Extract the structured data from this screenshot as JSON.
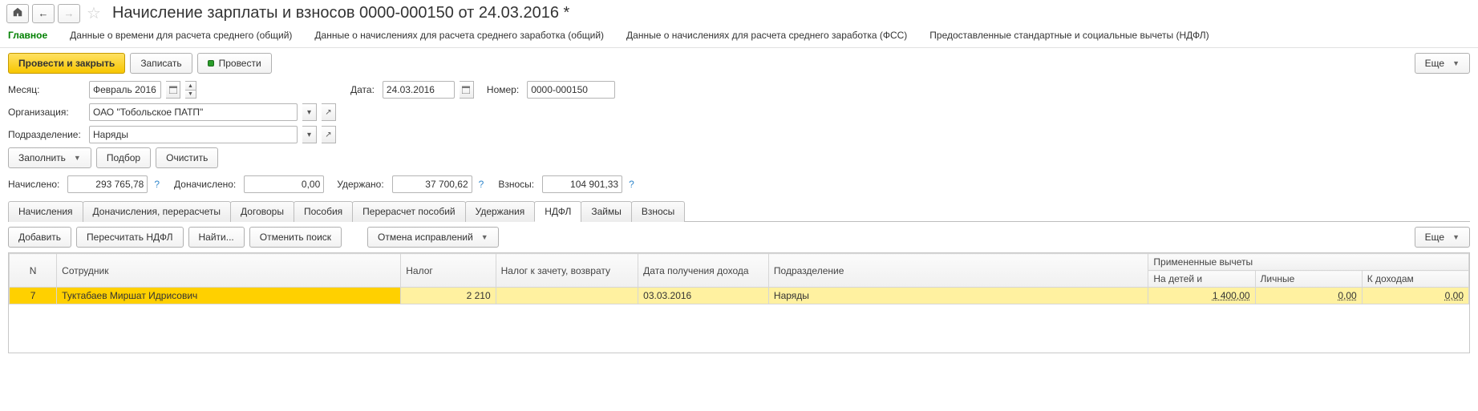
{
  "title": "Начисление зарплаты и взносов 0000-000150 от 24.03.2016 *",
  "subtabs": {
    "main": "Главное",
    "avgTime": "Данные о времени для расчета среднего (общий)",
    "avgEarnGeneral": "Данные о начислениях для расчета среднего заработка (общий)",
    "avgEarnFSS": "Данные о начислениях для расчета среднего заработка (ФСС)",
    "deductions": "Предоставленные стандартные и социальные вычеты (НДФЛ)"
  },
  "toolbar": {
    "postClose": "Провести и закрыть",
    "save": "Записать",
    "post": "Провести",
    "more": "Еще"
  },
  "form": {
    "monthLabel": "Месяц:",
    "month": "Февраль 2016",
    "dateLabel": "Дата:",
    "date": "24.03.2016",
    "numberLabel": "Номер:",
    "number": "0000-000150",
    "orgLabel": "Организация:",
    "org": "ОАО \"Тобольское ПАТП\"",
    "deptLabel": "Подразделение:",
    "dept": "Наряды"
  },
  "fillBar": {
    "fill": "Заполнить",
    "pick": "Подбор",
    "clear": "Очистить"
  },
  "totals": {
    "accruedLabel": "Начислено:",
    "accrued": "293 765,78",
    "extraLabel": "Доначислено:",
    "extra": "0,00",
    "withheldLabel": "Удержано:",
    "withheld": "37 700,62",
    "feesLabel": "Взносы:",
    "fees": "104 901,33"
  },
  "sectionTabs": {
    "accruals": "Начисления",
    "recalc": "Доначисления, перерасчеты",
    "contracts": "Договоры",
    "benefits": "Пособия",
    "benefitRecalc": "Перерасчет пособий",
    "withholdings": "Удержания",
    "ndfl": "НДФЛ",
    "loans": "Займы",
    "fees": "Взносы"
  },
  "gridToolbar": {
    "add": "Добавить",
    "recalcNdfl": "Пересчитать НДФЛ",
    "find": "Найти...",
    "cancelFind": "Отменить поиск",
    "cancelFix": "Отмена исправлений",
    "more": "Еще"
  },
  "grid": {
    "headers": {
      "n": "N",
      "employee": "Сотрудник",
      "tax": "Налог",
      "taxOffset": "Налог к зачету, возврату",
      "incomeDate": "Дата получения дохода",
      "department": "Подразделение",
      "appliedDeductions": "Примененные вычеты",
      "forChildren": "На детей и",
      "personal": "Личные",
      "toIncome": "К доходам"
    },
    "row": {
      "n": "7",
      "employee": "Туктабаев Миршат Идрисович",
      "tax": "2 210",
      "taxOffset": "",
      "incomeDate": "03.03.2016",
      "department": "Наряды",
      "forChildren": "1 400,00",
      "personal": "0,00",
      "toIncome": "0,00"
    }
  }
}
